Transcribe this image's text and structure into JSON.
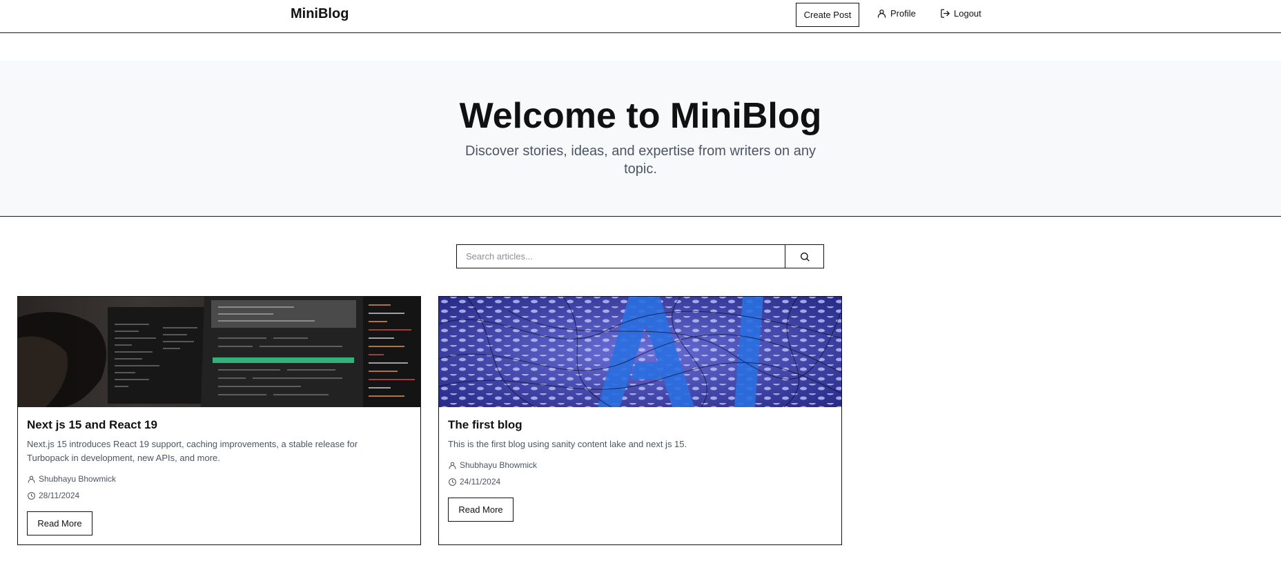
{
  "header": {
    "brand": "MiniBlog",
    "create_post_label": "Create Post",
    "profile_label": "Profile",
    "logout_label": "Logout"
  },
  "hero": {
    "title": "Welcome to MiniBlog",
    "subtitle": "Discover stories, ideas, and expertise from writers on any topic."
  },
  "search": {
    "placeholder": "Search articles...",
    "value": ""
  },
  "posts": [
    {
      "title": "Next js 15 and React 19",
      "excerpt": "Next.js 15 introduces React 19 support, caching improvements, a stable release for Turbopack in development, new APIs, and more.",
      "author": "Shubhayu Bhowmick",
      "date": "28/11/2024",
      "read_more_label": "Read More",
      "image_icon": "code-screen-photo"
    },
    {
      "title": "The first blog",
      "excerpt": "This is the first blog using sanity content lake and next js 15.",
      "author": "Shubhayu Bhowmick",
      "date": "24/11/2024",
      "read_more_label": "Read More",
      "image_icon": "ai-abstract-photo"
    }
  ],
  "icons": {
    "profile": "user-icon",
    "logout": "logout-icon",
    "search": "search-icon",
    "author": "user-icon",
    "date": "clock-icon"
  },
  "colors": {
    "hero_bg": "#f8f9fb",
    "text_muted": "#4b5563",
    "border": "#111111"
  }
}
